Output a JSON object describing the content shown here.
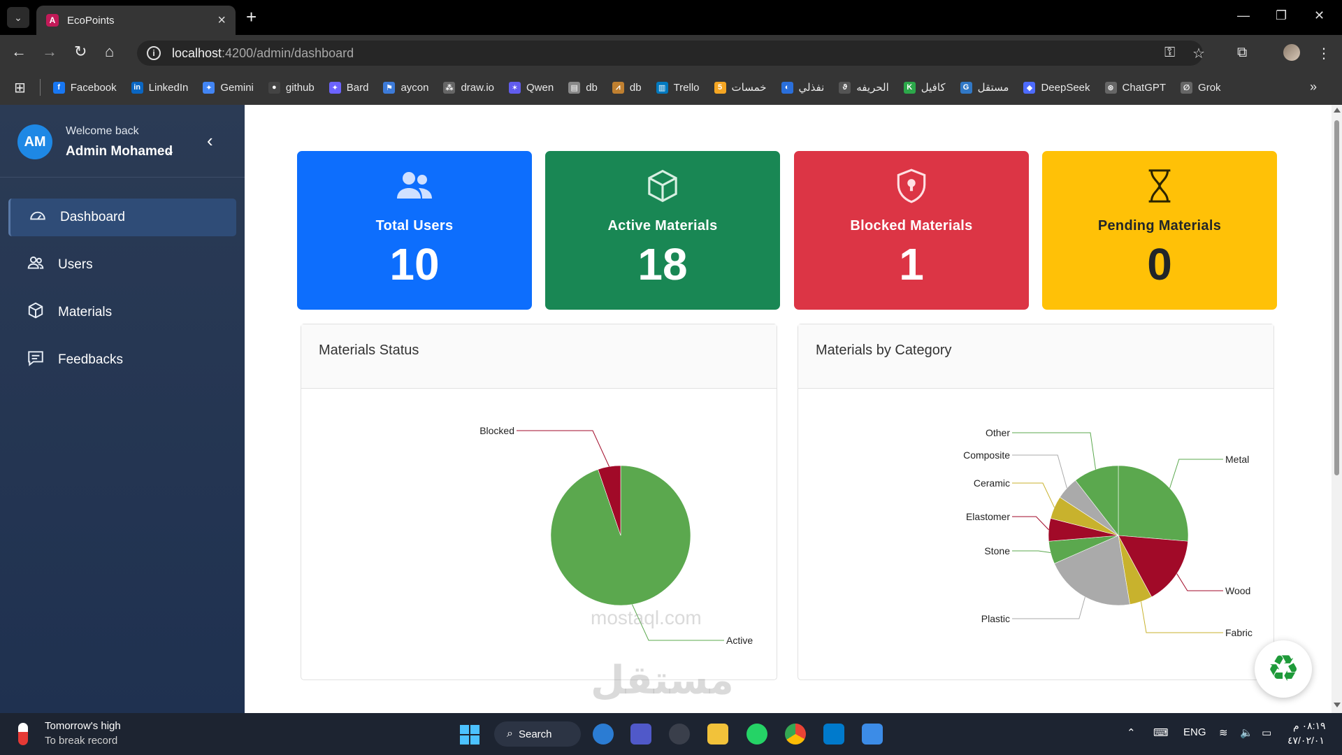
{
  "browser": {
    "tab_title": "EcoPoints",
    "url_host": "localhost",
    "url_path": ":4200/admin/dashboard",
    "bookmarks": [
      {
        "label": "Facebook",
        "color": "#1877f2",
        "glyph": "f"
      },
      {
        "label": "LinkedIn",
        "color": "#0a66c2",
        "glyph": "in"
      },
      {
        "label": "Gemini",
        "color": "#4285f4",
        "glyph": "✦"
      },
      {
        "label": "github",
        "color": "#444444",
        "glyph": "●"
      },
      {
        "label": "Bard",
        "color": "#6c63ff",
        "glyph": "✦"
      },
      {
        "label": "aycon",
        "color": "#3d7bd9",
        "glyph": "⚑"
      },
      {
        "label": "draw.io",
        "color": "#666666",
        "glyph": "⁂"
      },
      {
        "label": "Qwen",
        "color": "#615ced",
        "glyph": "✶"
      },
      {
        "label": "db",
        "color": "#888888",
        "glyph": "▤"
      },
      {
        "label": "db",
        "color": "#c08030",
        "glyph": "⩘"
      },
      {
        "label": "Trello",
        "color": "#0079bf",
        "glyph": "▥"
      },
      {
        "label": "خمسات",
        "color": "#f5a623",
        "glyph": "5"
      },
      {
        "label": "نفذلي",
        "color": "#2a6fdb",
        "glyph": "◐"
      },
      {
        "label": "الحريفه",
        "color": "#555555",
        "glyph": "ϑ"
      },
      {
        "label": "كافيل",
        "color": "#2ca84a",
        "glyph": "K"
      },
      {
        "label": "مستقل",
        "color": "#3178c6",
        "glyph": "G"
      },
      {
        "label": "DeepSeek",
        "color": "#4d6bfe",
        "glyph": "◆"
      },
      {
        "label": "ChatGPT",
        "color": "#666666",
        "glyph": "⊛"
      },
      {
        "label": "Grok",
        "color": "#666666",
        "glyph": "∅"
      }
    ]
  },
  "sidebar": {
    "avatar_initials": "AM",
    "welcome": "Welcome back",
    "user_name": "Admin Mohamed",
    "items": [
      {
        "label": "Dashboard",
        "icon": "gauge-icon",
        "active": true
      },
      {
        "label": "Users",
        "icon": "users-icon",
        "active": false
      },
      {
        "label": "Materials",
        "icon": "box-icon",
        "active": false
      },
      {
        "label": "Feedbacks",
        "icon": "chat-icon",
        "active": false
      }
    ]
  },
  "cards": [
    {
      "title": "Total Users",
      "value": "10",
      "bg": "#0d6efd",
      "fg": "#ffffff",
      "icon": "users-icon"
    },
    {
      "title": "Active Materials",
      "value": "18",
      "bg": "#198754",
      "fg": "#ffffff",
      "icon": "box-icon"
    },
    {
      "title": "Blocked Materials",
      "value": "1",
      "bg": "#dc3545",
      "fg": "#ffffff",
      "icon": "shield-lock-icon"
    },
    {
      "title": "Pending Materials",
      "value": "0",
      "bg": "#ffc107",
      "fg": "#212529",
      "icon": "hourglass-icon"
    }
  ],
  "panels": {
    "status_title": "Materials Status",
    "category_title": "Materials by Category"
  },
  "chart_data": [
    {
      "type": "pie",
      "title": "Materials Status",
      "categories": [
        "Active",
        "Blocked"
      ],
      "values": [
        18,
        1
      ],
      "colors": [
        "#5ba84e",
        "#a10a28"
      ]
    },
    {
      "type": "pie",
      "title": "Materials by Category",
      "categories": [
        "Metal",
        "Wood",
        "Fabric",
        "Plastic",
        "Stone",
        "Elastomer",
        "Ceramic",
        "Composite",
        "Other"
      ],
      "values": [
        5,
        3,
        1,
        4,
        1,
        1,
        1,
        1,
        2
      ],
      "colors": [
        "#5ba84e",
        "#a10a28",
        "#c8b22d",
        "#aaaaaa",
        "#5ba84e",
        "#a10a28",
        "#c8b22d",
        "#aaaaaa",
        "#5ba84e"
      ]
    }
  ],
  "taskbar": {
    "weather_line1": "Tomorrow's high",
    "weather_line2": "To break record",
    "search_label": "Search",
    "lang": "ENG",
    "time": "٠٨:١٩ م",
    "date": "٤٧/٠٢/٠١"
  },
  "watermark": {
    "main": "مستقل",
    "sub": "mostaql.com"
  }
}
